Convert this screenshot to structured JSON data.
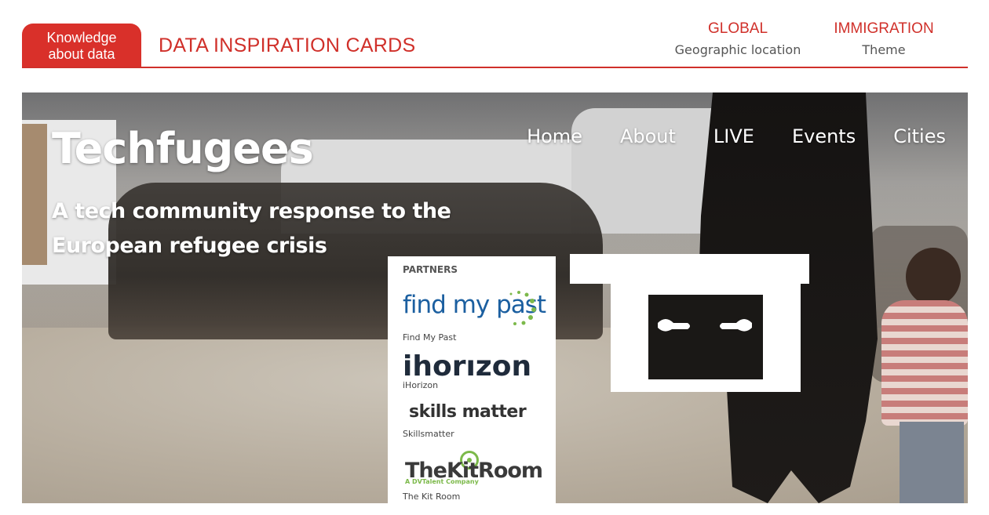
{
  "header": {
    "tag": "Knowledge\nabout data",
    "title": "DATA INSPIRATION CARDS",
    "location": {
      "value": "GLOBAL",
      "label": "Geographic location"
    },
    "theme": {
      "value": "IMMIGRATION",
      "label": "Theme"
    },
    "accent_color": "#d0302a"
  },
  "site": {
    "title": "Techfugees",
    "nav": [
      "Home",
      "About",
      "LIVE",
      "Events",
      "Cities"
    ],
    "tagline": "A tech community response to the\nEuropean refugee crisis",
    "logo_icon": "tf-hands-logo"
  },
  "partners": {
    "heading": "PARTNERS",
    "items": [
      {
        "logo_text": "find my past",
        "caption": "Find My Past"
      },
      {
        "logo_text": "ihorızon",
        "caption": "iHorizon"
      },
      {
        "logo_text": "skills matter",
        "caption": "Skillsmatter"
      },
      {
        "logo_text": "TheKitRoom",
        "logo_subtext": "A DVTalent Company",
        "caption": "The Kit Room"
      }
    ]
  }
}
